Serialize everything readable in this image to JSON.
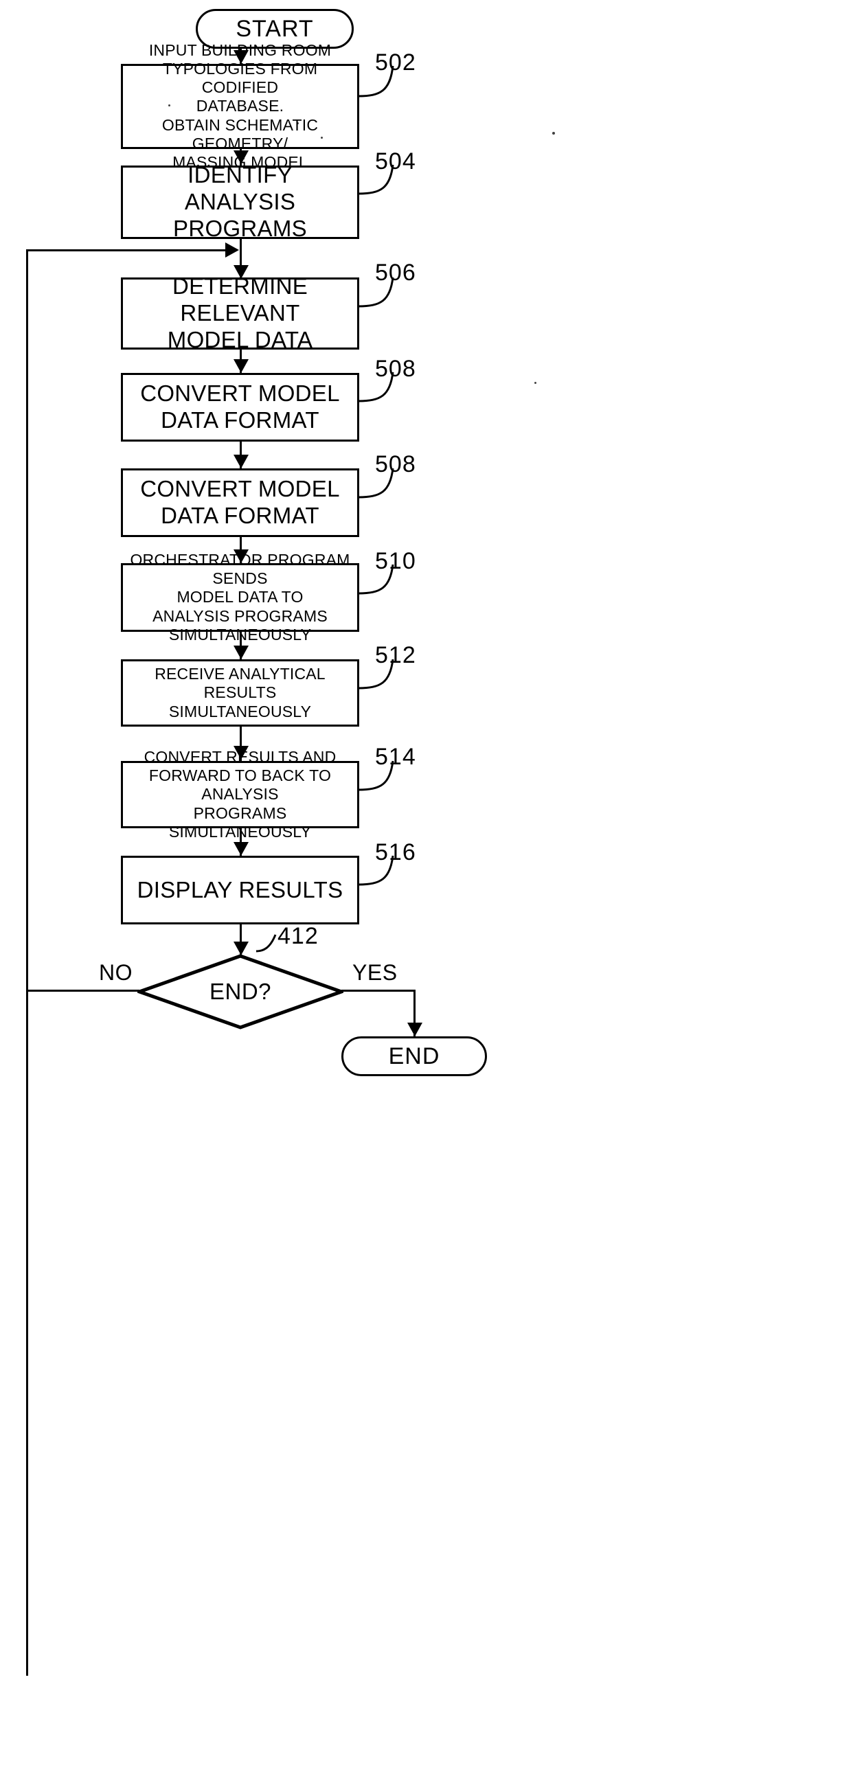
{
  "figure": {
    "type": "patent-flowchart",
    "orientation": "vertical"
  },
  "nodes": {
    "start": {
      "label": "START",
      "shape": "terminal"
    },
    "n502": {
      "label": "INPUT BUILDING ROOM\nTYPOLOGIES FROM CODIFIED\nDATABASE.\nOBTAIN SCHEMATIC GEOMETRY/\nMASSING MODEL",
      "shape": "process",
      "ref": "502"
    },
    "n504": {
      "label": "IDENTIFY\nANALYSIS PROGRAMS",
      "shape": "process",
      "ref": "504"
    },
    "n506": {
      "label": "DETERMINE RELEVANT\nMODEL DATA",
      "shape": "process",
      "ref": "506"
    },
    "n508a": {
      "label": "CONVERT MODEL\nDATA FORMAT",
      "shape": "process",
      "ref": "508"
    },
    "n508b": {
      "label": "CONVERT MODEL\nDATA FORMAT",
      "shape": "process",
      "ref": "508"
    },
    "n510": {
      "label": "ORCHESTRATOR PROGRAM SENDS\nMODEL DATA TO\nANALYSIS PROGRAMS\nSIMULTANEOUSLY",
      "shape": "process",
      "ref": "510"
    },
    "n512": {
      "label": "RECEIVE ANALYTICAL RESULTS\nSIMULTANEOUSLY",
      "shape": "process",
      "ref": "512"
    },
    "n514": {
      "label": "CONVERT RESULTS AND\nFORWARD TO BACK TO ANALYSIS\nPROGRAMS SIMULTANEOUSLY",
      "shape": "process",
      "ref": "514"
    },
    "n516": {
      "label": "DISPLAY RESULTS",
      "shape": "process",
      "ref": "516"
    },
    "decision": {
      "label": "END?",
      "shape": "diamond",
      "ref": "412"
    },
    "end": {
      "label": "END",
      "shape": "terminal"
    }
  },
  "branches": {
    "no": "NO",
    "yes": "YES"
  },
  "refs": {
    "r502": "502",
    "r504": "504",
    "r506": "506",
    "r508a": "508",
    "r508b": "508",
    "r510": "510",
    "r512": "512",
    "r514": "514",
    "r516": "516",
    "r412": "412"
  },
  "colors": {
    "stroke": "#000000",
    "background": "#ffffff"
  }
}
